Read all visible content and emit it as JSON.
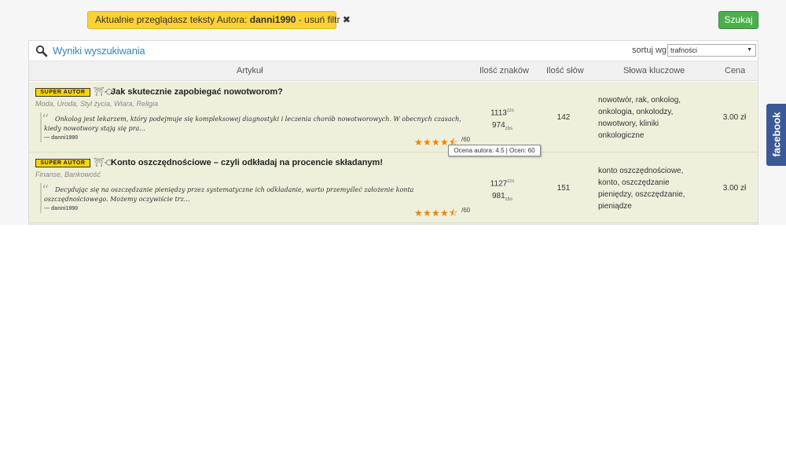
{
  "filter": {
    "prefix": "Aktualnie przeglądasz teksty Autora: ",
    "author": "danni1990",
    "remove_label": " - usuń filtr ",
    "remove_icon": "✖"
  },
  "search_button": "Szukaj",
  "results": {
    "title": "Wyniki wyszukiwania",
    "sort_label": "sortuj wg",
    "sort_value": "trafności",
    "columns": {
      "article": "Artykuł",
      "chars": "Ilość znaków",
      "words": "Ilość słów",
      "keywords": "Słowa kluczowe",
      "price": "Cena"
    },
    "rows": [
      {
        "badge": "SUPER AUTOR",
        "glyph": "⛩⛮",
        "title": "Jak skutecznie zapobiegać nowotworom?",
        "categories": "Moda, Uroda, Styl życia, Wiara, Religia",
        "excerpt": "Onkolog jest lekarzem, który podejmuje się kompleksowej diagnostyki i leczenia chorób nowotworowych. W obecnych czasach, kiedy nowotwory stają się pra...",
        "author": "— danni1990",
        "rating_count": "/60",
        "rating": 4.5,
        "chars_zzs": "1113",
        "chars_zzs_unit": "zzs",
        "chars_zbs": "974",
        "chars_zbs_unit": "zbs",
        "words": "142",
        "keywords": "nowotwór, rak, onkolog, onkologia, onkolodzy, nowotwory, kliniki onkologiczne",
        "price": "3.00 zł"
      },
      {
        "badge": "SUPER AUTOR",
        "glyph": "⛩⛮",
        "title": "Konto oszczędnościowe – czyli odkładaj na procencie składanym!",
        "categories": "Finanse, Bankowość",
        "excerpt": "Decydując się na oszczędzanie pieniędzy przez systematyczne ich odkładanie, warto przemyśleć założenie konta oszczędnościowego. Możemy oczywiście trz...",
        "author": "— danni1990",
        "rating_count": "/60",
        "rating": 4.5,
        "chars_zzs": "1127",
        "chars_zzs_unit": "zzs",
        "chars_zbs": "981",
        "chars_zbs_unit": "zbs",
        "words": "151",
        "keywords": "konto oszczędnościowe, konto, oszczędzanie pieniędzy, oszczędzanie, pieniądze",
        "price": "3.00 zł"
      }
    ]
  },
  "tooltip": "Ocena autora: 4.5 | Ocen: 60",
  "facebook_tab": "facebook",
  "colors": {
    "filter_bg": "#fbd235",
    "search_btn": "#4cae4c",
    "row_bg": "#eef0dc",
    "title_blue": "#3b83b8",
    "star": "#f08300",
    "facebook": "#3b5998"
  },
  "icons": {
    "search": "magnifier-icon",
    "sort": "chevron-down-icon",
    "quote": "quote-icon",
    "star": "star-icon"
  }
}
